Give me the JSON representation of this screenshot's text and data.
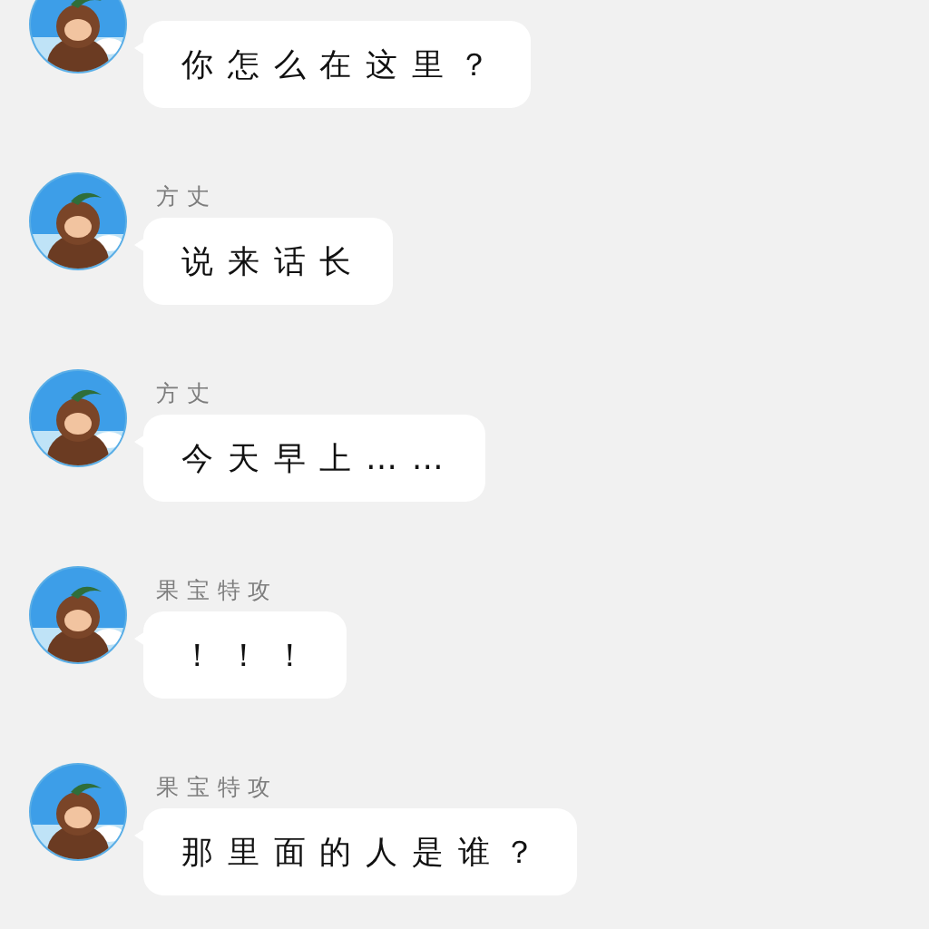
{
  "messages": [
    {
      "text": "你怎么在这里？"
    },
    {
      "sender": "方丈",
      "text": "说来话长"
    },
    {
      "sender": "方丈",
      "text": "今天早上……"
    },
    {
      "sender": "果宝特攻",
      "text": "！！！"
    },
    {
      "sender": "果宝特攻",
      "text": "那里面的人是谁？"
    }
  ]
}
